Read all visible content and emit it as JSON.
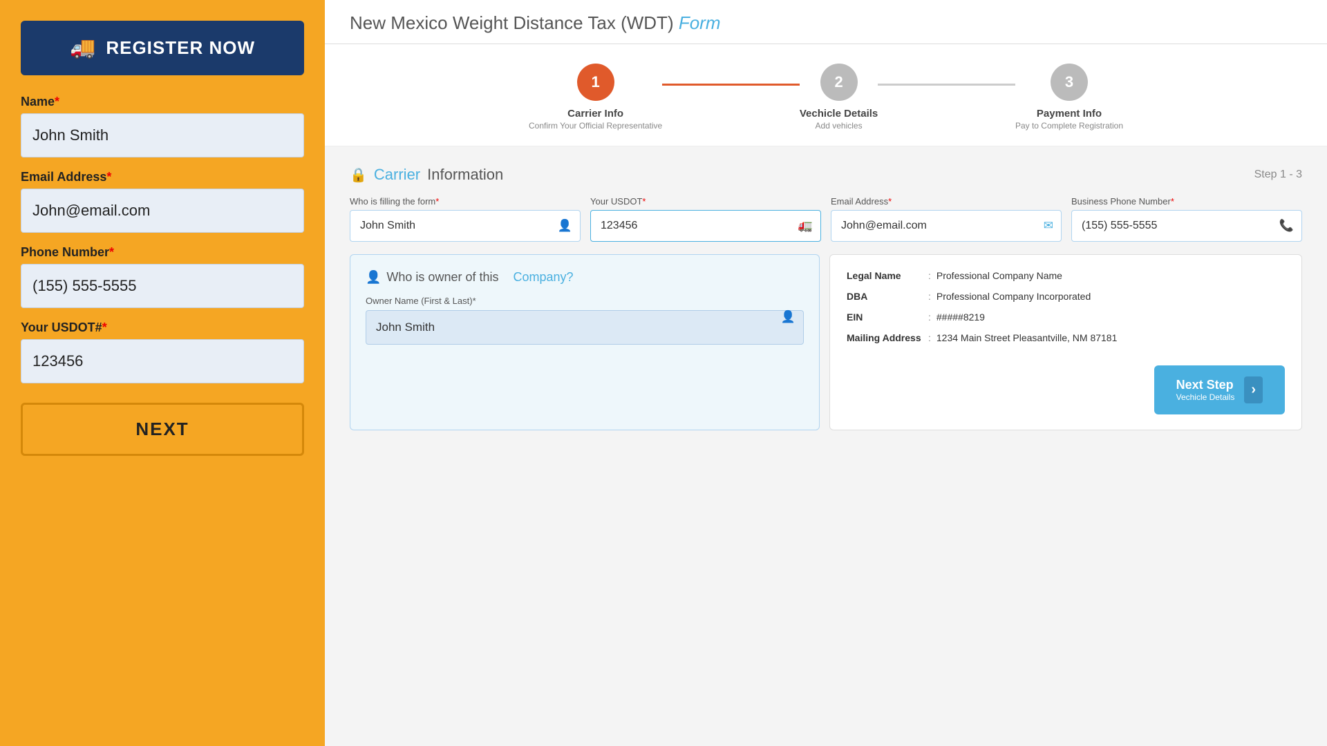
{
  "left": {
    "register_label": "REGISTER NOW",
    "truck_icon": "🚚",
    "fields": [
      {
        "label": "Name",
        "required": true,
        "value": "John Smith",
        "name": "name-input"
      },
      {
        "label": "Email Address",
        "required": true,
        "value": "John@email.com",
        "name": "email-input"
      },
      {
        "label": "Phone Number",
        "required": true,
        "value": "(155) 555-5555",
        "name": "phone-input"
      },
      {
        "label": "Your USDOT#",
        "required": true,
        "value": "123456",
        "name": "usdot-input"
      }
    ],
    "next_label": "NEXT"
  },
  "right": {
    "title_main": "New Mexico Weight Distance Tax (WDT)",
    "title_form": "Form",
    "steps": [
      {
        "num": "1",
        "label": "Carrier Info",
        "sub": "Confirm Your Official Representative",
        "active": true
      },
      {
        "num": "2",
        "label": "Vechicle Details",
        "sub": "Add vehicles",
        "active": false
      },
      {
        "num": "3",
        "label": "Payment Info",
        "sub": "Pay to Complete Registration",
        "active": false
      }
    ],
    "section_title_prefix": "Carrier",
    "section_title_suffix": "Information",
    "step_label": "Step 1 - 3",
    "who_filling_label": "Who is filling the form",
    "usdot_label": "Your USDOT",
    "email_label": "Email Address",
    "phone_label": "Business Phone Number",
    "who_filling_value": "John Smith",
    "usdot_value": "123456",
    "email_value": "John@email.com",
    "phone_value": "(155) 555-5555",
    "owner_section_title_pre": "Who is owner of this",
    "owner_section_title_company": "Company?",
    "owner_name_label": "Owner Name (First & Last)",
    "owner_name_value": "John Smith",
    "info": {
      "legal_name_key": "Legal Name",
      "legal_name_val": "Professional Company Name",
      "dba_key": "DBA",
      "dba_val": "Professional Company Incorporated",
      "ein_key": "EIN",
      "ein_val": "#####8219",
      "mailing_key": "Mailing Address",
      "mailing_val": "1234 Main Street Pleasantville, NM 87181"
    },
    "next_step_main": "Next Step",
    "next_step_sub": "Vechicle Details"
  }
}
